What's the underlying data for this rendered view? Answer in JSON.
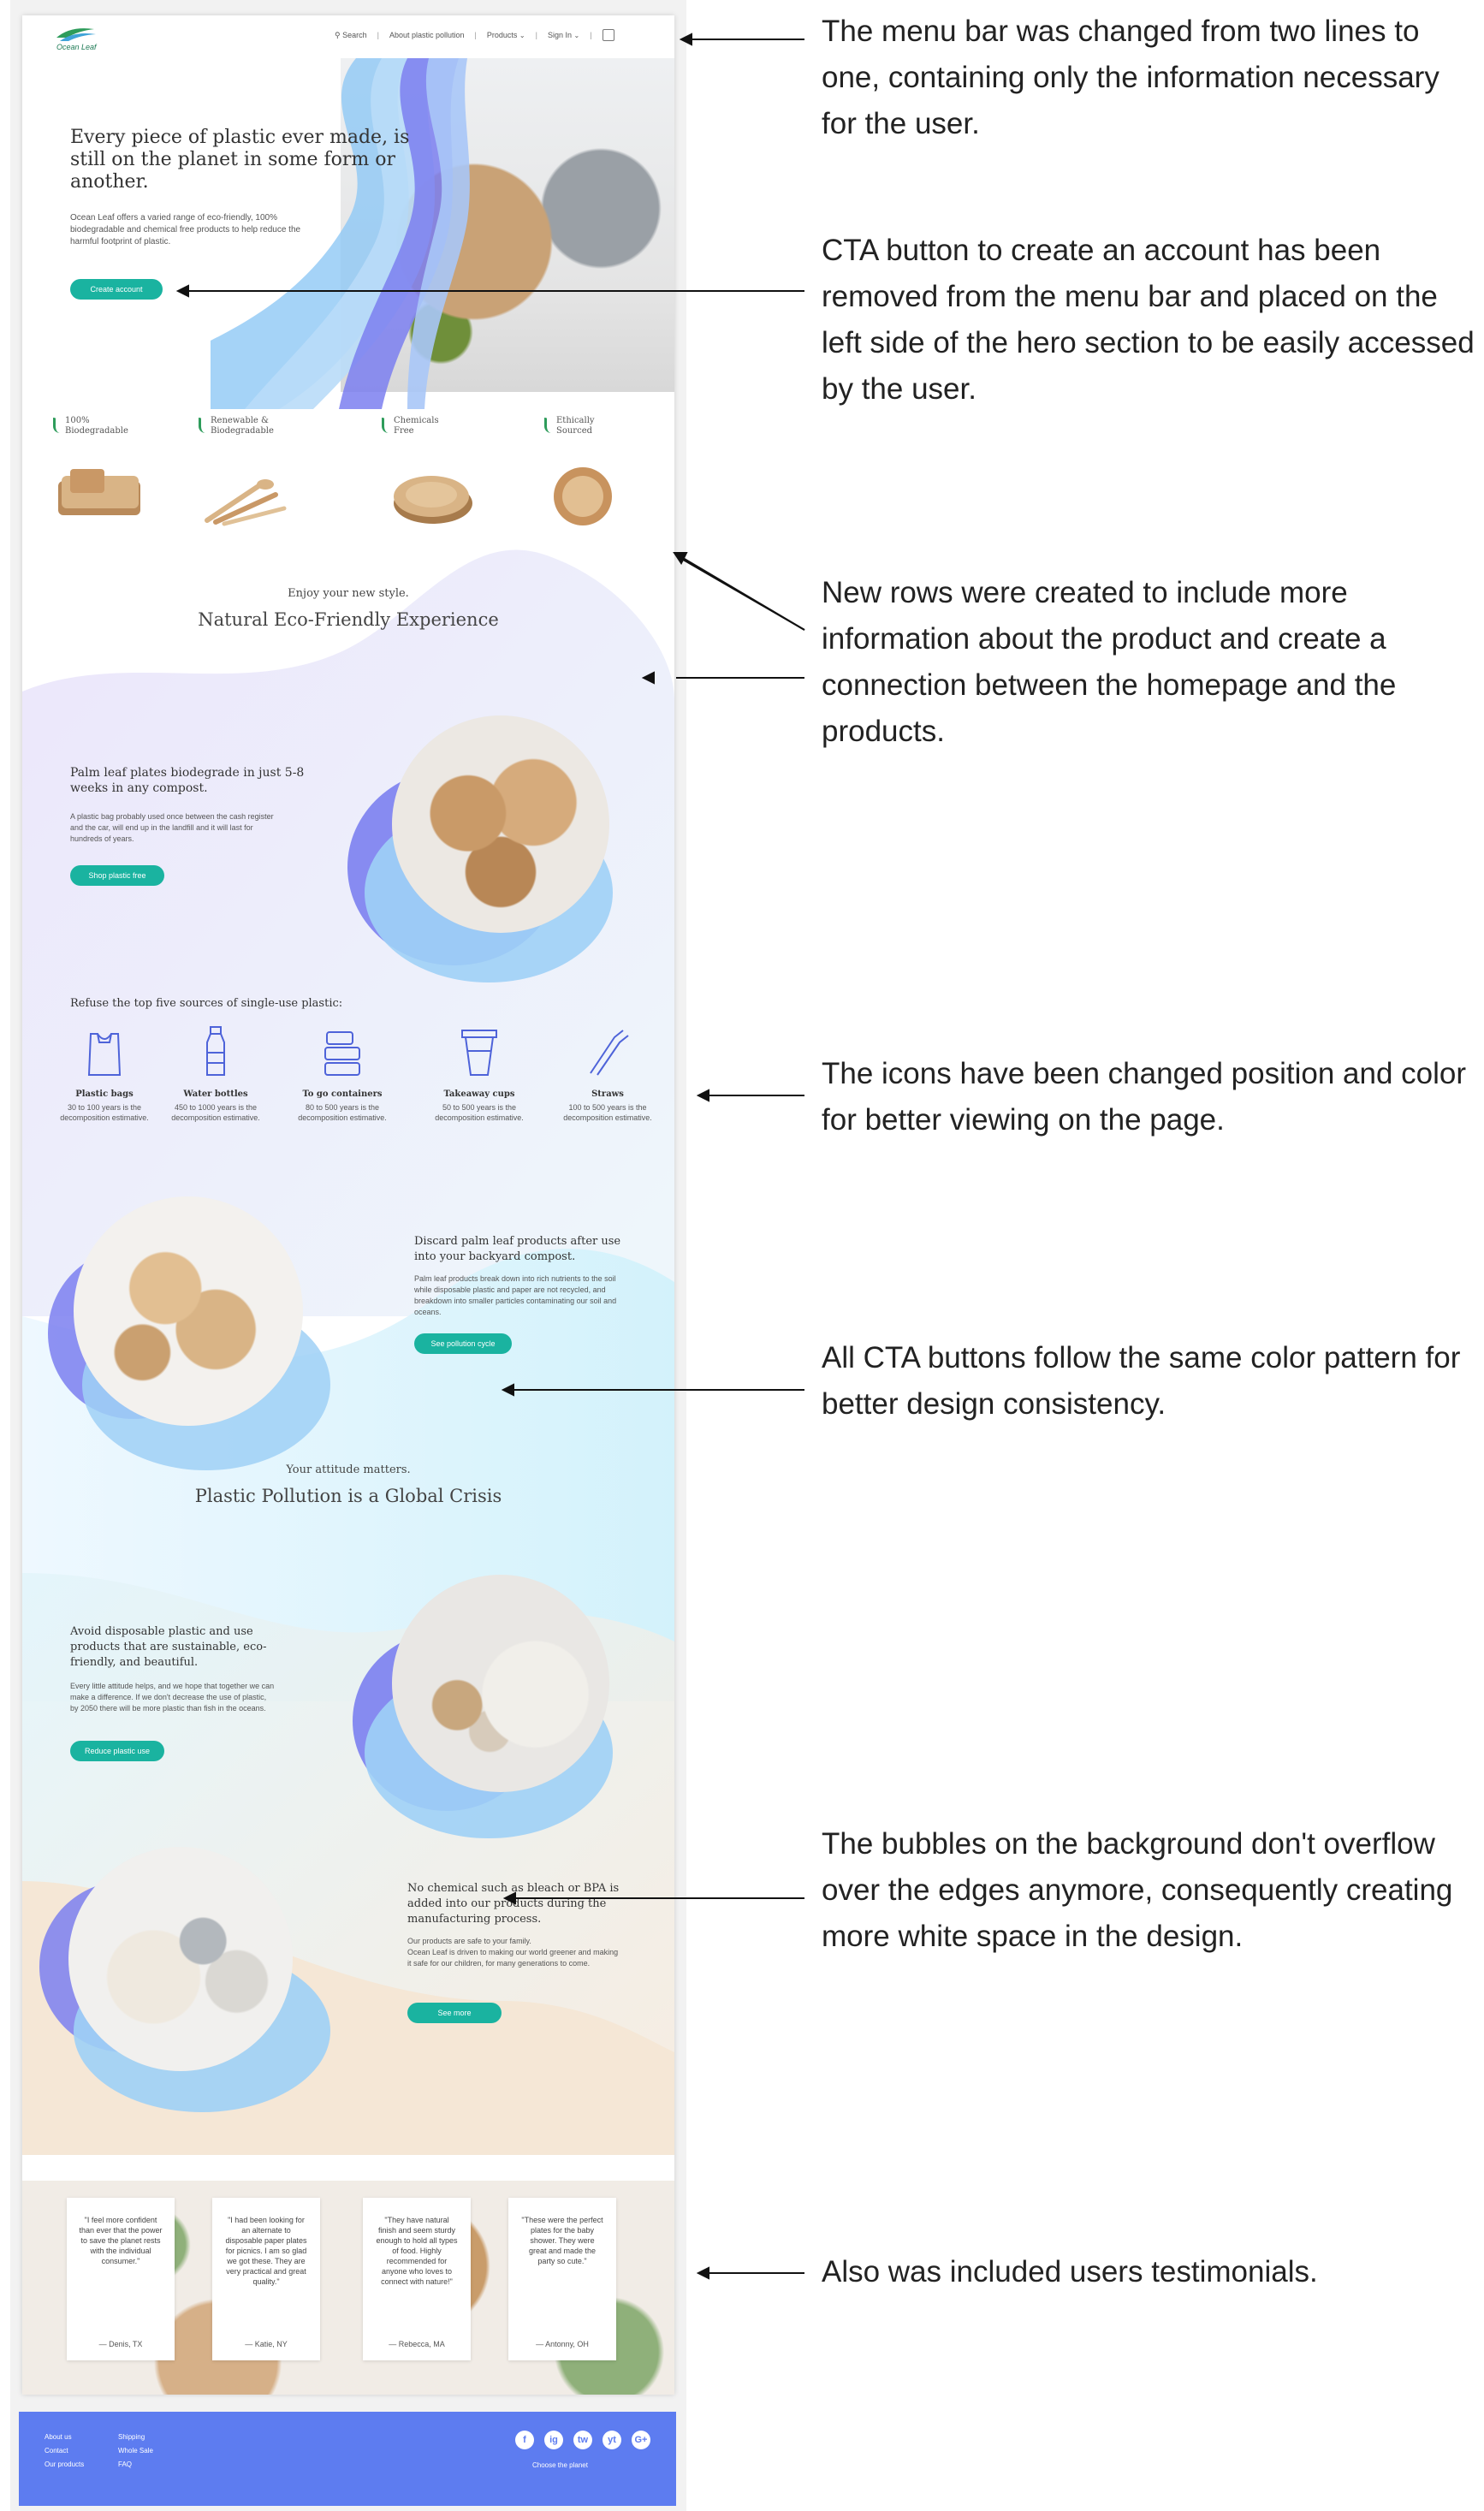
{
  "nav": {
    "brand": "Ocean Leaf",
    "search": "Search",
    "about": "About plastic pollution",
    "products": "Products",
    "signin": "Sign In"
  },
  "hero": {
    "title": "Every piece of plastic ever made, is still on the planet in some form or another.",
    "text": "Ocean Leaf offers a varied range of eco-friendly, 100% biodegradable and chemical free products to help reduce the harmful footprint of plastic.",
    "button": "Create account"
  },
  "features": [
    {
      "label": "100%\nBiodegradable"
    },
    {
      "label": "Renewable &\nBiodegradable"
    },
    {
      "label": "Chemicals\nFree"
    },
    {
      "label": "Ethically\nSourced"
    }
  ],
  "experience": {
    "kicker": "Enjoy your new style.",
    "headline": "Natural Eco-Friendly Experience"
  },
  "palm": {
    "title": "Palm leaf plates biodegrade in just 5-8 weeks in any compost.",
    "text": "A plastic bag probably used once between the cash register and the car, will end up in the landfill and it will last for hundreds of years.",
    "button": "Shop plastic free"
  },
  "refuse": {
    "title": "Refuse the top five sources of single-use plastic:",
    "items": [
      {
        "name": "Plastic bags",
        "desc": "30 to 100 years is the decomposition estimative.",
        "icon": "plastic-bag-icon"
      },
      {
        "name": "Water bottles",
        "desc": "450 to 1000 years is the decomposition estimative.",
        "icon": "water-bottle-icon"
      },
      {
        "name": "To go containers",
        "desc": "80 to 500 years is the decomposition estimative.",
        "icon": "container-icon"
      },
      {
        "name": "Takeaway cups",
        "desc": "50 to 500 years is the decomposition estimative.",
        "icon": "takeaway-cup-icon"
      },
      {
        "name": "Straws",
        "desc": "100 to 500 years is the decomposition estimative.",
        "icon": "straw-icon"
      }
    ]
  },
  "discard": {
    "title": "Discard palm leaf products after use into your backyard compost.",
    "text": "Palm leaf products break down into rich nutrients to the soil while disposable plastic and paper are not recycled, and breakdown into smaller particles contaminating our soil and oceans.",
    "button": "See pollution cycle"
  },
  "crisis": {
    "kicker": "Your attitude matters.",
    "headline": "Plastic Pollution is a Global Crisis"
  },
  "avoid": {
    "title": "Avoid disposable plastic and use products that are sustainable, eco-friendly, and beautiful.",
    "text": "Every little attitude helps, and we hope that together we can make a difference. If we don't decrease the use of plastic, by 2050 there will be more plastic than fish in the oceans.",
    "button": "Reduce plastic use"
  },
  "chemical": {
    "title": "No chemical such as bleach or BPA is added into our products during the manufacturing process.",
    "text": "Our products are safe to your family.\nOcean Leaf is driven to making our world greener and making it safe for our children, for many generations to come.",
    "button": "See more"
  },
  "testimonials": [
    {
      "quote": "\"I feel more confident than ever that the power to save the planet rests with the individual consumer.\"",
      "author": "— Denis, TX"
    },
    {
      "quote": "\"I had been looking for an alternate to disposable paper plates for picnics. I am so glad we got these. They are very practical and great quality.\"",
      "author": "— Katie, NY"
    },
    {
      "quote": "\"They have natural finish and seem sturdy enough to hold all types of food. Highly recommended for anyone who loves to connect with nature!\"",
      "author": "— Rebecca, MA"
    },
    {
      "quote": "\"These were the perfect plates for the baby shower. They were great and made the party so cute.\"",
      "author": "— Antonny, OH"
    }
  ],
  "footer": {
    "col1": [
      "About us",
      "Contact",
      "Our products"
    ],
    "col2": [
      "Shipping",
      "Whole Sale",
      "FAQ"
    ],
    "social": [
      "f",
      "ig",
      "tw",
      "yt",
      "G+"
    ],
    "tagline": "Choose the planet"
  },
  "annotations": [
    "The menu bar was changed from two lines to one, containing only the information necessary for the user.",
    "CTA button to create an account has been removed from the menu bar and placed on the left side of the hero section to be easily accessed by the user.",
    "New rows were created to include more information about the product and create a connection between the homepage and the products.",
    "The icons have been changed position and color for better viewing on the page.",
    "All CTA buttons follow the same color pattern for better design consistency.",
    "The bubbles on the background don't overflow over the edges anymore, consequently creating more white space in the design.",
    "Also was included users testimonials."
  ],
  "colors": {
    "accent": "#1ab3a0",
    "footer": "#5d7cf0",
    "wave_purple": "#7b7ff0",
    "wave_blue": "#8ec8f5"
  }
}
